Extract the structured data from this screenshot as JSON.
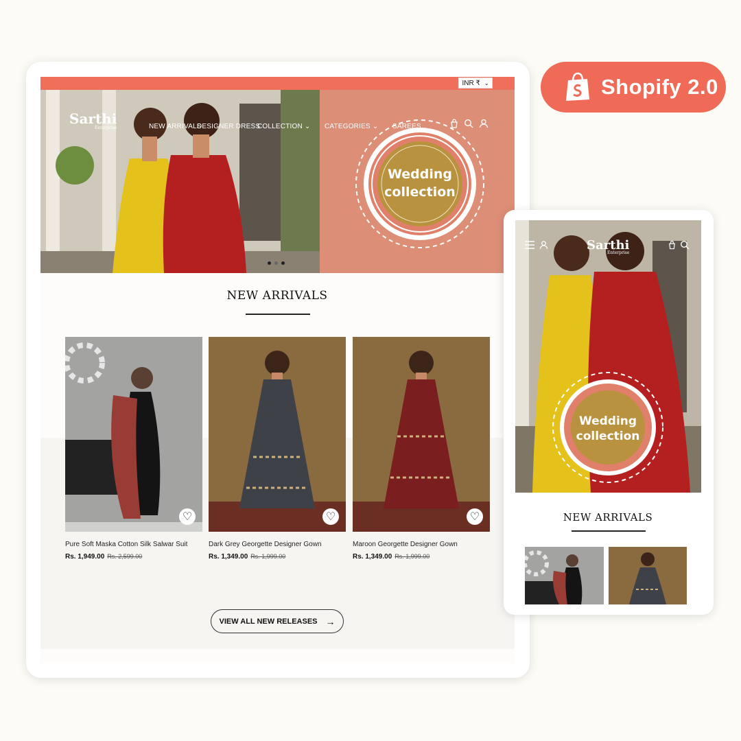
{
  "colors": {
    "accent": "#ef6f5b",
    "banner": "#dd8e76",
    "medallion": "#b8923e"
  },
  "badge": {
    "label": "Shopify 2.0",
    "icon": "shopify-bag-icon"
  },
  "desktop": {
    "currency": {
      "label": "INR ₹"
    },
    "logo": {
      "name": "Sarthi",
      "tagline": "Enterprise"
    },
    "nav": [
      "NEW ARRIVALS",
      "DESIGNER DRESS",
      "COLLECTION",
      "CATEGORIES",
      "SAREES"
    ],
    "hero": {
      "line1": "Wedding",
      "line2": "collection",
      "slides": 3
    },
    "section_title": "NEW ARRIVALS",
    "products": [
      {
        "name": "Pure Soft Maska Cotton Silk Salwar Suit",
        "price": "Rs. 1,949.00",
        "compare": "Rs. 2,599.00"
      },
      {
        "name": "Dark Grey Georgette Designer Gown",
        "price": "Rs. 1,349.00",
        "compare": "Rs. 1,999.00"
      },
      {
        "name": "Maroon Georgette Designer Gown",
        "price": "Rs. 1,349.00",
        "compare": "Rs. 1,999.00"
      }
    ],
    "view_all": "VIEW ALL NEW RELEASES"
  },
  "mobile": {
    "logo": {
      "name": "Sarthi",
      "tagline": "Enterprise"
    },
    "hero": {
      "line1": "Wedding",
      "line2": "collection"
    },
    "section_title": "NEW ARRIVALS"
  }
}
